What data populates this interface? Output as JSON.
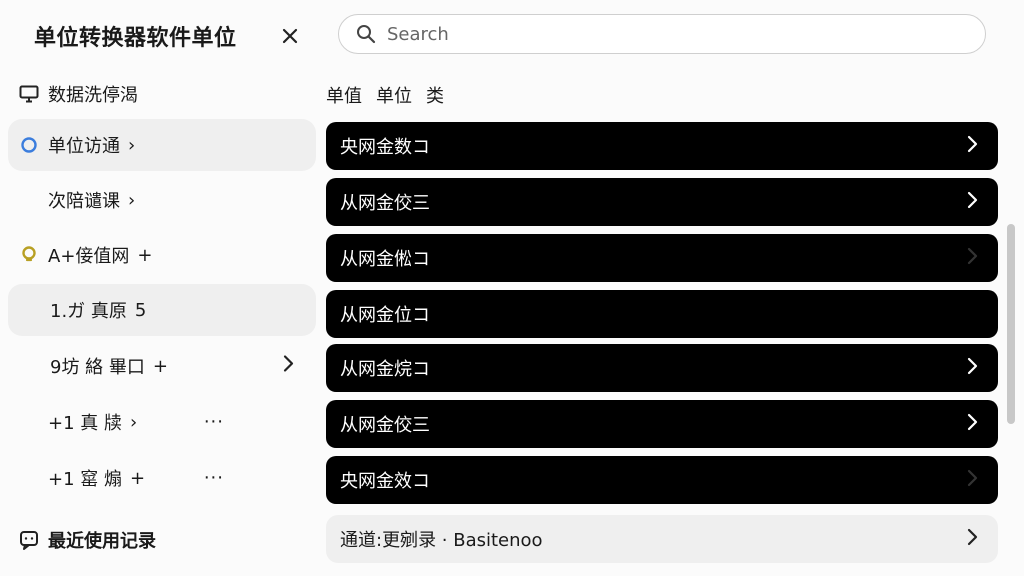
{
  "header": {
    "title": "单位转换器软件单位",
    "close_icon": "close-icon",
    "search_placeholder": "Search"
  },
  "sidebar": {
    "items": [
      {
        "label": "数据洗停渴",
        "suffix": "",
        "icon": "monitor-icon"
      },
      {
        "label": "单位访通",
        "suffix": "›",
        "icon": "circle-icon",
        "accent": "#3b7ddd"
      },
      {
        "label": "次陪谴课",
        "suffix": "›"
      },
      {
        "label": "A+倿值网",
        "suffix": "+",
        "icon": "lightbulb-icon",
        "accent": "#b8a024"
      },
      {
        "label": "1.ガ 真原",
        "suffix": "5"
      },
      {
        "label": "9坊 絡 畢口",
        "suffix": "+"
      },
      {
        "label": "+1 真 牍",
        "suffix": "›",
        "more": "···"
      },
      {
        "label": "+1 窰 煽",
        "suffix": "+",
        "more": "···"
      }
    ],
    "recent_label": "最近使用记录"
  },
  "columns": [
    "单值",
    "单位",
    "类"
  ],
  "rows": [
    {
      "label": "央网金数コ",
      "chevron_dim": false
    },
    {
      "label": "从网金佼三",
      "chevron_dim": false
    },
    {
      "label": "从网金倯コ",
      "chevron_dim": true
    },
    {
      "label": "从网金位コ",
      "chevron_dim": true
    },
    {
      "label": "从网金烷コ",
      "chevron_dim": false
    },
    {
      "label": "从网金佼三",
      "chevron_dim": false
    },
    {
      "label": "央网金效コ",
      "chevron_dim": true
    }
  ],
  "recent_row": {
    "label": "通道:更剜录 · Basitenoo"
  },
  "colors": {
    "row_bg": "#000000",
    "active_bg": "#efefef",
    "accent_blue": "#3b7ddd",
    "accent_yellow": "#b8a024"
  }
}
